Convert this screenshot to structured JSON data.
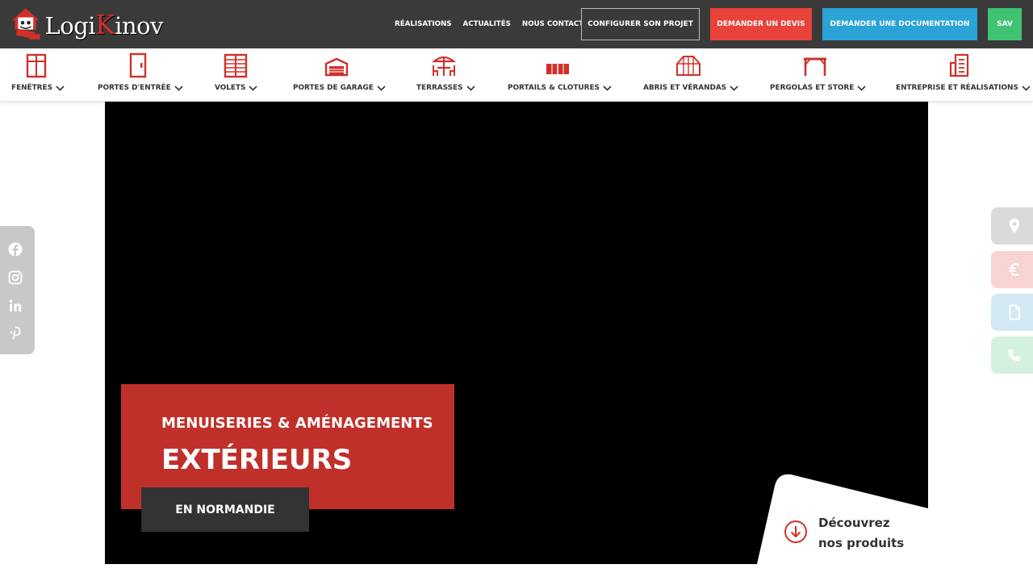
{
  "header": {
    "logo_text_a": "Logi",
    "logo_text_k": "K",
    "logo_text_b": "inov",
    "links": [
      "RÉALISATIONS",
      "ACTUALITÉS",
      "NOUS CONTACTER"
    ],
    "configure_label": "CONFIGURER SON PROJET",
    "quote_label": "DEMANDER UN DEVIS",
    "doc_label": "DEMANDER UNE DOCUMENTATION",
    "sav_label": "SAV"
  },
  "categories": [
    {
      "label": "FENÊTRES",
      "icon": "window-icon"
    },
    {
      "label": "PORTES D'ENTRÉE",
      "icon": "door-icon"
    },
    {
      "label": "VOLETS",
      "icon": "shutter-icon"
    },
    {
      "label": "PORTES DE GARAGE",
      "icon": "garage-icon"
    },
    {
      "label": "TERRASSES",
      "icon": "terrace-table-icon"
    },
    {
      "label": "PORTAILS & CLOTURES",
      "icon": "gate-icon"
    },
    {
      "label": "ABRIS ET VÉRANDAS",
      "icon": "veranda-icon"
    },
    {
      "label": "PERGOLAS ET STORE",
      "icon": "pergola-icon"
    },
    {
      "label": "ENTREPRISE ET RÉALISATIONS",
      "icon": "building-icon"
    }
  ],
  "hero": {
    "subtitle": "MENUISERIES & AMÉNAGEMENTS",
    "title": "EXTÉRIEURS",
    "region": "EN NORMANDIE",
    "discover_line1": "Découvrez",
    "discover_line2": "nos produits"
  },
  "social": [
    "facebook-icon",
    "instagram-icon",
    "linkedin-icon",
    "pinterest-icon"
  ],
  "side_tabs": [
    "location-pin-icon",
    "euro-icon",
    "document-icon",
    "phone-icon"
  ],
  "colors": {
    "topbar": "#3a3a3a",
    "red_accent": "#c0302a",
    "quote_red": "#e8433a",
    "doc_blue": "#2ba3d6",
    "sav_green": "#3fc272",
    "icon_red": "#d0302a"
  }
}
